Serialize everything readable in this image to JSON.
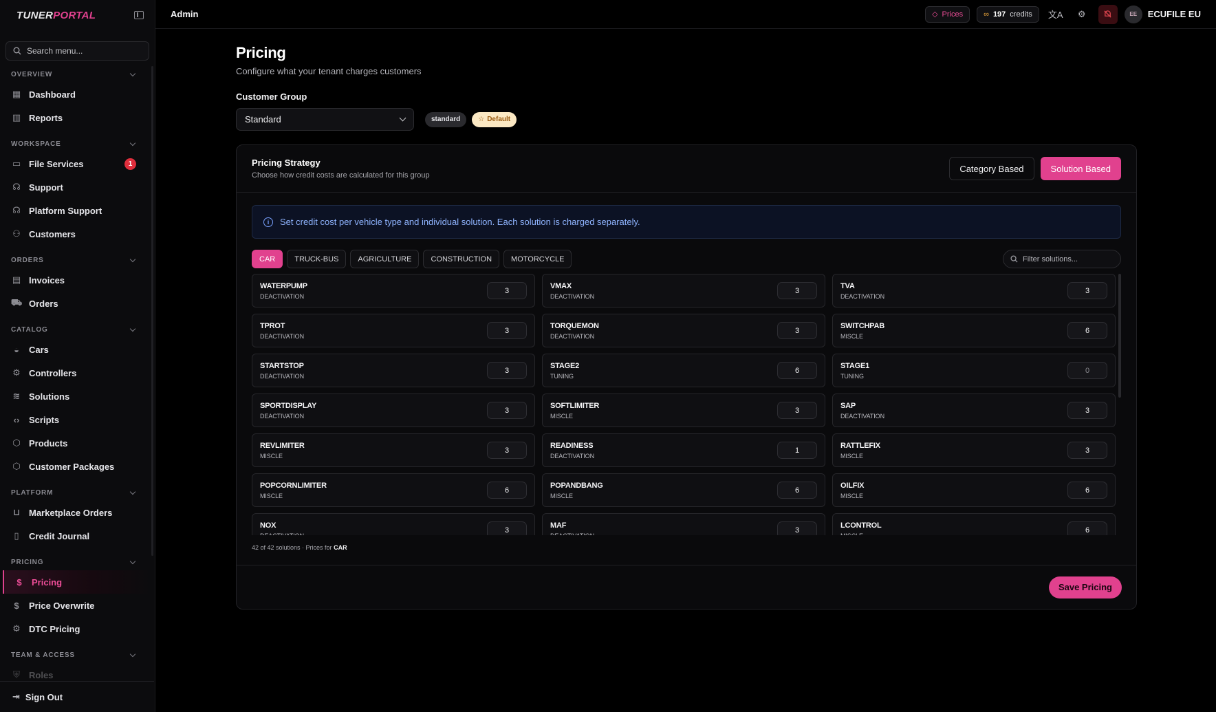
{
  "app": {
    "logo_part1": "TUNER",
    "logo_part2": "PORTAL",
    "breadcrumb": "Admin"
  },
  "sidebar": {
    "search_placeholder": "Search menu...",
    "sections": [
      {
        "title": "OVERVIEW",
        "items": [
          {
            "label": "Dashboard",
            "icon": "grid-icon"
          },
          {
            "label": "Reports",
            "icon": "bar-chart-icon"
          }
        ]
      },
      {
        "title": "WORKSPACE",
        "items": [
          {
            "label": "File Services",
            "icon": "folder-icon",
            "badge": "1"
          },
          {
            "label": "Support",
            "icon": "headset-icon"
          },
          {
            "label": "Platform Support",
            "icon": "headphones-icon"
          },
          {
            "label": "Customers",
            "icon": "users-icon"
          }
        ]
      },
      {
        "title": "ORDERS",
        "items": [
          {
            "label": "Invoices",
            "icon": "invoice-icon"
          },
          {
            "label": "Orders",
            "icon": "cart-icon"
          }
        ]
      },
      {
        "title": "CATALOG",
        "items": [
          {
            "label": "Cars",
            "icon": "car-icon"
          },
          {
            "label": "Controllers",
            "icon": "chip-icon"
          },
          {
            "label": "Solutions",
            "icon": "layers-icon"
          },
          {
            "label": "Scripts",
            "icon": "code-icon"
          },
          {
            "label": "Products",
            "icon": "box-icon"
          },
          {
            "label": "Customer Packages",
            "icon": "package-icon"
          }
        ]
      },
      {
        "title": "PLATFORM",
        "items": [
          {
            "label": "Marketplace Orders",
            "icon": "inbox-icon"
          },
          {
            "label": "Credit Journal",
            "icon": "book-icon"
          }
        ]
      },
      {
        "title": "PRICING",
        "items": [
          {
            "label": "Pricing",
            "icon": "dollar-icon",
            "active": true
          },
          {
            "label": "Price Overwrite",
            "icon": "dollar-icon"
          },
          {
            "label": "DTC Pricing",
            "icon": "chip-icon"
          }
        ]
      },
      {
        "title": "TEAM & ACCESS",
        "items": [
          {
            "label": "Roles",
            "icon": "shield-icon"
          }
        ]
      }
    ],
    "sign_out": "Sign Out"
  },
  "topbar": {
    "prices_label": "Prices",
    "credits_value": "197",
    "credits_label": "credits",
    "avatar_initials": "EE",
    "user_name": "ECUFILE EU"
  },
  "page": {
    "title": "Pricing",
    "subtitle": "Configure what your tenant charges customers",
    "customer_group_label": "Customer Group",
    "customer_group_value": "Standard",
    "tag_standard": "standard",
    "tag_default": "Default"
  },
  "strategy": {
    "title": "Pricing Strategy",
    "subtitle": "Choose how credit costs are calculated for this group",
    "option_category": "Category Based",
    "option_solution": "Solution Based",
    "info_text": "Set credit cost per vehicle type and individual solution. Each solution is charged separately.",
    "vehicle_tabs": [
      "CAR",
      "TRUCK-BUS",
      "AGRICULTURE",
      "CONSTRUCTION",
      "MOTORCYCLE"
    ],
    "active_tab": "CAR",
    "filter_placeholder": "Filter solutions...",
    "solutions": [
      {
        "name": "WATERPUMP",
        "category": "DEACTIVATION",
        "value": "3"
      },
      {
        "name": "VMAX",
        "category": "DEACTIVATION",
        "value": "3"
      },
      {
        "name": "TVA",
        "category": "DEACTIVATION",
        "value": "3"
      },
      {
        "name": "TPROT",
        "category": "DEACTIVATION",
        "value": "3"
      },
      {
        "name": "TORQUEMON",
        "category": "DEACTIVATION",
        "value": "3"
      },
      {
        "name": "SWITCHPAB",
        "category": "MISCLE",
        "value": "6"
      },
      {
        "name": "STARTSTOP",
        "category": "DEACTIVATION",
        "value": "3"
      },
      {
        "name": "STAGE2",
        "category": "TUNING",
        "value": "6"
      },
      {
        "name": "STAGE1",
        "category": "TUNING",
        "value": "0"
      },
      {
        "name": "SPORTDISPLAY",
        "category": "DEACTIVATION",
        "value": "3"
      },
      {
        "name": "SOFTLIMITER",
        "category": "MISCLE",
        "value": "3"
      },
      {
        "name": "SAP",
        "category": "DEACTIVATION",
        "value": "3"
      },
      {
        "name": "REVLIMITER",
        "category": "MISCLE",
        "value": "3"
      },
      {
        "name": "READINESS",
        "category": "DEACTIVATION",
        "value": "1"
      },
      {
        "name": "RATTLEFIX",
        "category": "MISCLE",
        "value": "3"
      },
      {
        "name": "POPCORNLIMITER",
        "category": "MISCLE",
        "value": "6"
      },
      {
        "name": "POPANDBANG",
        "category": "MISCLE",
        "value": "6"
      },
      {
        "name": "OILFIX",
        "category": "MISCLE",
        "value": "6"
      },
      {
        "name": "NOX",
        "category": "DEACTIVATION",
        "value": "3"
      },
      {
        "name": "MAF",
        "category": "DEACTIVATION",
        "value": "3"
      },
      {
        "name": "LCONTROL",
        "category": "MISCLE",
        "value": "6"
      }
    ],
    "summary_prefix": "42 of 42 solutions · Prices for",
    "summary_vehicle": "CAR",
    "save_label": "Save Pricing"
  }
}
